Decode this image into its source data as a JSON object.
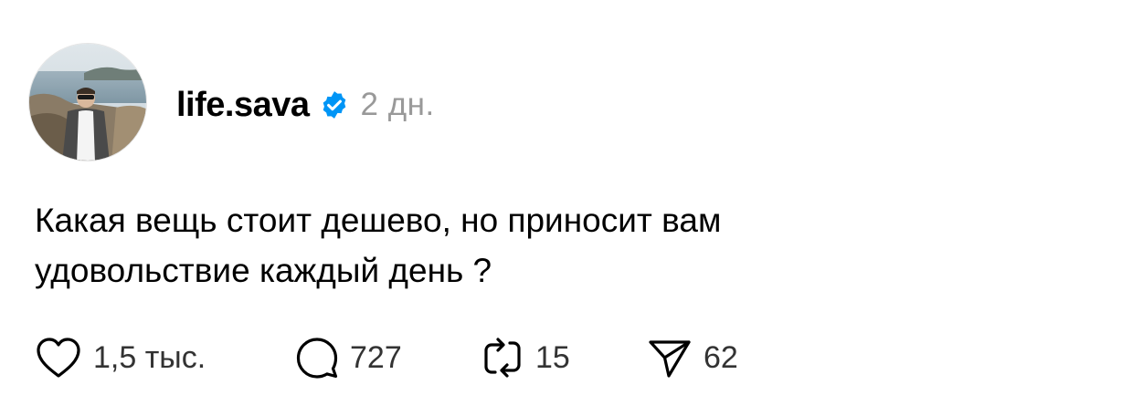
{
  "post": {
    "author": {
      "username": "life.sava",
      "verified": true,
      "verified_color": "#0095F6"
    },
    "time_ago": "2 дн.",
    "text_lines": [
      "Какая вещь стоит дешево, но приносит вам",
      "удовольствие каждый день ?"
    ],
    "actions": {
      "like": {
        "icon": "heart-icon",
        "count": "1,5 тыс."
      },
      "reply": {
        "icon": "comment-icon",
        "count": "727"
      },
      "repost": {
        "icon": "repost-icon",
        "count": "15"
      },
      "share": {
        "icon": "send-icon",
        "count": "62"
      }
    }
  }
}
